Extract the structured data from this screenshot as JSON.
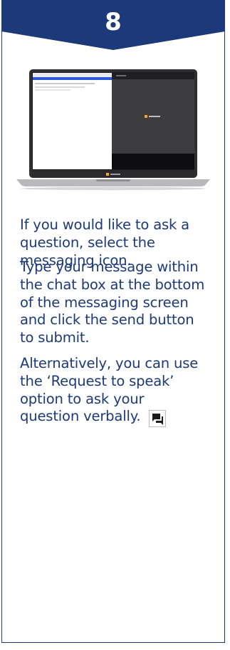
{
  "step": {
    "number": "8"
  },
  "instructions": {
    "p1": "If you would like to ask a question, select the messaging icon.",
    "p2": "Type your message within the chat box at the bottom of the messaging screen and click the send button to submit.",
    "p3": "Alternatively, you can use the ‘Request to speak’ option to ask your question verbally."
  },
  "icons": {
    "step_banner": "chevron-banner",
    "laptop": "laptop-screenshot",
    "messaging": "chat-bubbles-icon"
  },
  "colors": {
    "brand_navy": "#1c3a7a",
    "text_navy": "#1c3a7a",
    "accent_orange": "#f5a623"
  }
}
